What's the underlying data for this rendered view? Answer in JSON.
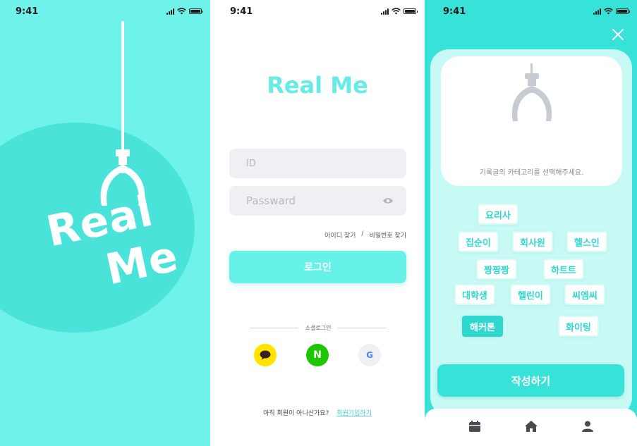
{
  "status_bar": {
    "time": "9:41"
  },
  "splash": {
    "logo_line1": "Real",
    "logo_line2": "Me"
  },
  "login": {
    "title": "Real Me",
    "id_placeholder": "ID",
    "password_placeholder": "Passward",
    "find_id": "아이디 찾기",
    "separator": "/",
    "find_password": "비밀번호 찾기",
    "login_button": "로그인",
    "social_label": "소셜로그인",
    "naver_letter": "N",
    "google_letter": "G",
    "signup_prompt": "아직 회원이 아니신가요?",
    "signup_link": "회원가입하기"
  },
  "category": {
    "hint": "기록글의 카테고리를 선택해주세요.",
    "chips": [
      {
        "label": "요리사",
        "active": false
      },
      {
        "label": "집순이",
        "active": false
      },
      {
        "label": "회사원",
        "active": false
      },
      {
        "label": "헬스인",
        "active": false
      },
      {
        "label": "짱짱짱",
        "active": false
      },
      {
        "label": "하트트",
        "active": false
      },
      {
        "label": "대학생",
        "active": false
      },
      {
        "label": "헬린이",
        "active": false
      },
      {
        "label": "씨엠씨",
        "active": false
      },
      {
        "label": "해커톤",
        "active": true
      },
      {
        "label": "화이팅",
        "active": false
      }
    ],
    "write_button": "작성하기"
  },
  "colors": {
    "accent": "#37e2d9",
    "splash_bg": "#6ef2ea",
    "kakao": "#fde500",
    "naver": "#1ec800"
  }
}
